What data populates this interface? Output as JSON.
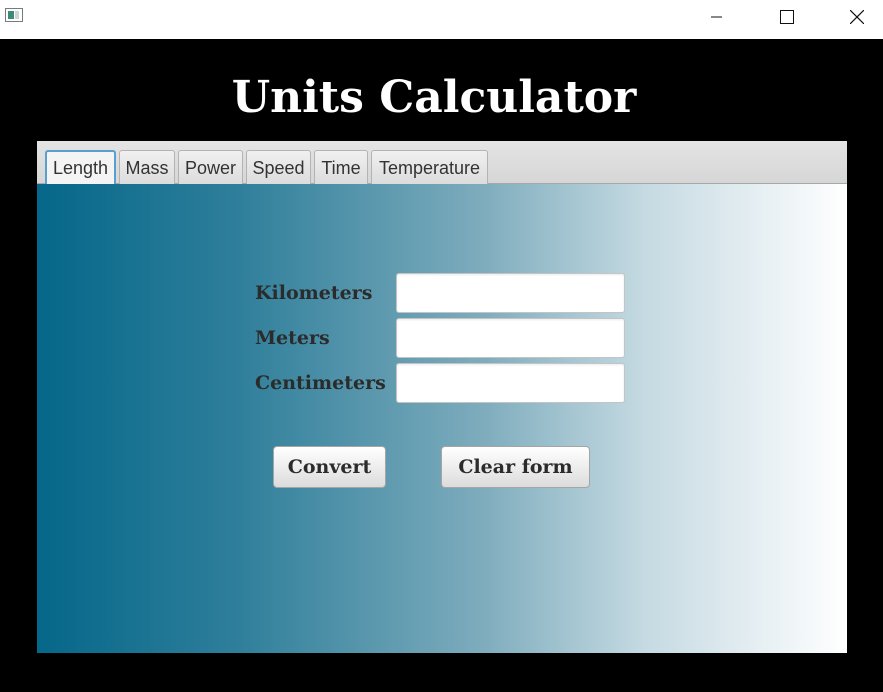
{
  "app": {
    "title": "Units Calculator"
  },
  "window_controls": {
    "minimize": "—",
    "maximize": "☐",
    "close": "✕"
  },
  "tabs": [
    {
      "label": "Length",
      "active": true
    },
    {
      "label": "Mass",
      "active": false
    },
    {
      "label": "Power",
      "active": false
    },
    {
      "label": "Speed",
      "active": false
    },
    {
      "label": "Time",
      "active": false
    },
    {
      "label": "Temperature",
      "active": false
    }
  ],
  "form": {
    "fields": [
      {
        "label": "Kilometers",
        "value": ""
      },
      {
        "label": "Meters",
        "value": ""
      },
      {
        "label": "Centimeters",
        "value": ""
      }
    ],
    "convert_label": "Convert",
    "clear_label": "Clear form"
  },
  "colors": {
    "gradient_start": "#05678a",
    "gradient_end": "#ffffff",
    "active_tab_border": "#5aa0cf"
  }
}
